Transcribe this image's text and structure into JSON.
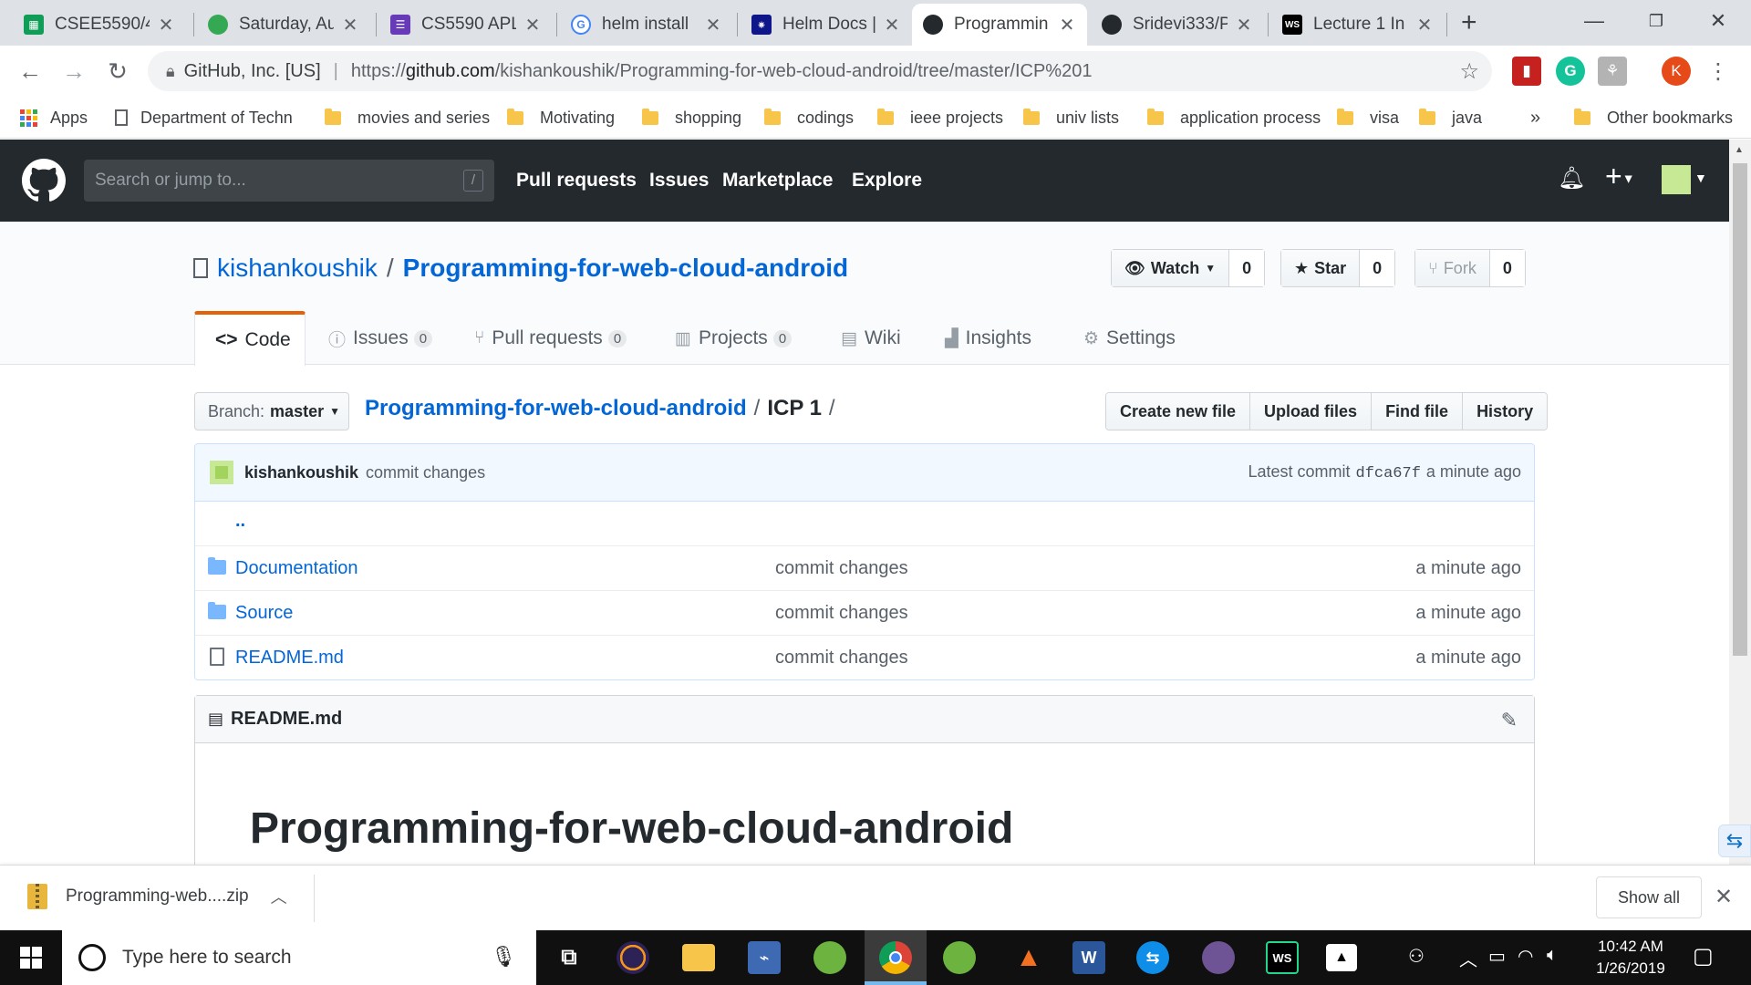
{
  "browser": {
    "tabs": [
      {
        "title": "CSEE5590/4",
        "favicon": "sheets-icon",
        "color": "#0f9d58"
      },
      {
        "title": "Saturday, Au",
        "favicon": "photos-icon",
        "color": "#34a853"
      },
      {
        "title": "CS5590 APL",
        "favicon": "forms-icon",
        "color": "#673ab7"
      },
      {
        "title": "helm install",
        "favicon": "google-icon",
        "color": "#4285f4"
      },
      {
        "title": "Helm Docs |",
        "favicon": "helm-icon",
        "color": "#0f1689"
      },
      {
        "title": "Programmin",
        "favicon": "github-icon",
        "color": "#24292e"
      },
      {
        "title": "Sridevi333/P",
        "favicon": "github-icon",
        "color": "#24292e"
      },
      {
        "title": "Lecture 1 In",
        "favicon": "webstorm-icon",
        "color": "#000000"
      }
    ],
    "address": {
      "org": "GitHub, Inc. [US]",
      "url_prefix": "https://",
      "url_host": "github.com",
      "url_path": "/kishankoushik/Programming-for-web-cloud-android/tree/master/ICP%201"
    },
    "profile_initial": "K",
    "bookmarks": {
      "apps": "Apps",
      "items": [
        "Department of Techn",
        "movies and series",
        "Motivating",
        "shopping",
        "codings",
        "ieee projects",
        "univ lists",
        "application process",
        "visa",
        "java"
      ],
      "overflow": "»",
      "other": "Other bookmarks"
    }
  },
  "github": {
    "search_placeholder": "Search or jump to...",
    "search_shortcut": "/",
    "nav": [
      "Pull requests",
      "Issues",
      "Marketplace",
      "Explore"
    ],
    "repo": {
      "owner": "kishankoushik",
      "separator": "/",
      "name": "Programming-for-web-cloud-android",
      "watch": {
        "label": "Watch",
        "count": "0"
      },
      "star": {
        "label": "Star",
        "count": "0"
      },
      "fork": {
        "label": "Fork",
        "count": "0"
      }
    },
    "tabs": [
      {
        "label": "Code",
        "count": ""
      },
      {
        "label": "Issues",
        "count": "0"
      },
      {
        "label": "Pull requests",
        "count": "0"
      },
      {
        "label": "Projects",
        "count": "0"
      },
      {
        "label": "Wiki",
        "count": ""
      },
      {
        "label": "Insights",
        "count": ""
      },
      {
        "label": "Settings",
        "count": ""
      }
    ],
    "branch": {
      "prefix": "Branch:",
      "name": "master"
    },
    "breadcrumb": {
      "root": "Programming-for-web-cloud-android",
      "folder": "ICP 1",
      "sep": "/"
    },
    "file_buttons": [
      "Create new file",
      "Upload files",
      "Find file",
      "History"
    ],
    "commit": {
      "author": "kishankoushik",
      "message": "commit changes",
      "latest_label": "Latest commit",
      "sha": "dfca67f",
      "age": "a minute ago"
    },
    "parent_dir": "..",
    "files": [
      {
        "name": "Documentation",
        "type": "dir",
        "message": "commit changes",
        "age": "a minute ago"
      },
      {
        "name": "Source",
        "type": "dir",
        "message": "commit changes",
        "age": "a minute ago"
      },
      {
        "name": "README.md",
        "type": "file",
        "message": "commit changes",
        "age": "a minute ago"
      }
    ],
    "readme": {
      "filename": "README.md",
      "heading": "Programming-for-web-cloud-android"
    }
  },
  "download_shelf": {
    "file": "Programming-web....zip",
    "show_all": "Show all"
  },
  "taskbar": {
    "search_placeholder": "Type here to search",
    "time": "10:42 AM",
    "date": "1/26/2019"
  }
}
